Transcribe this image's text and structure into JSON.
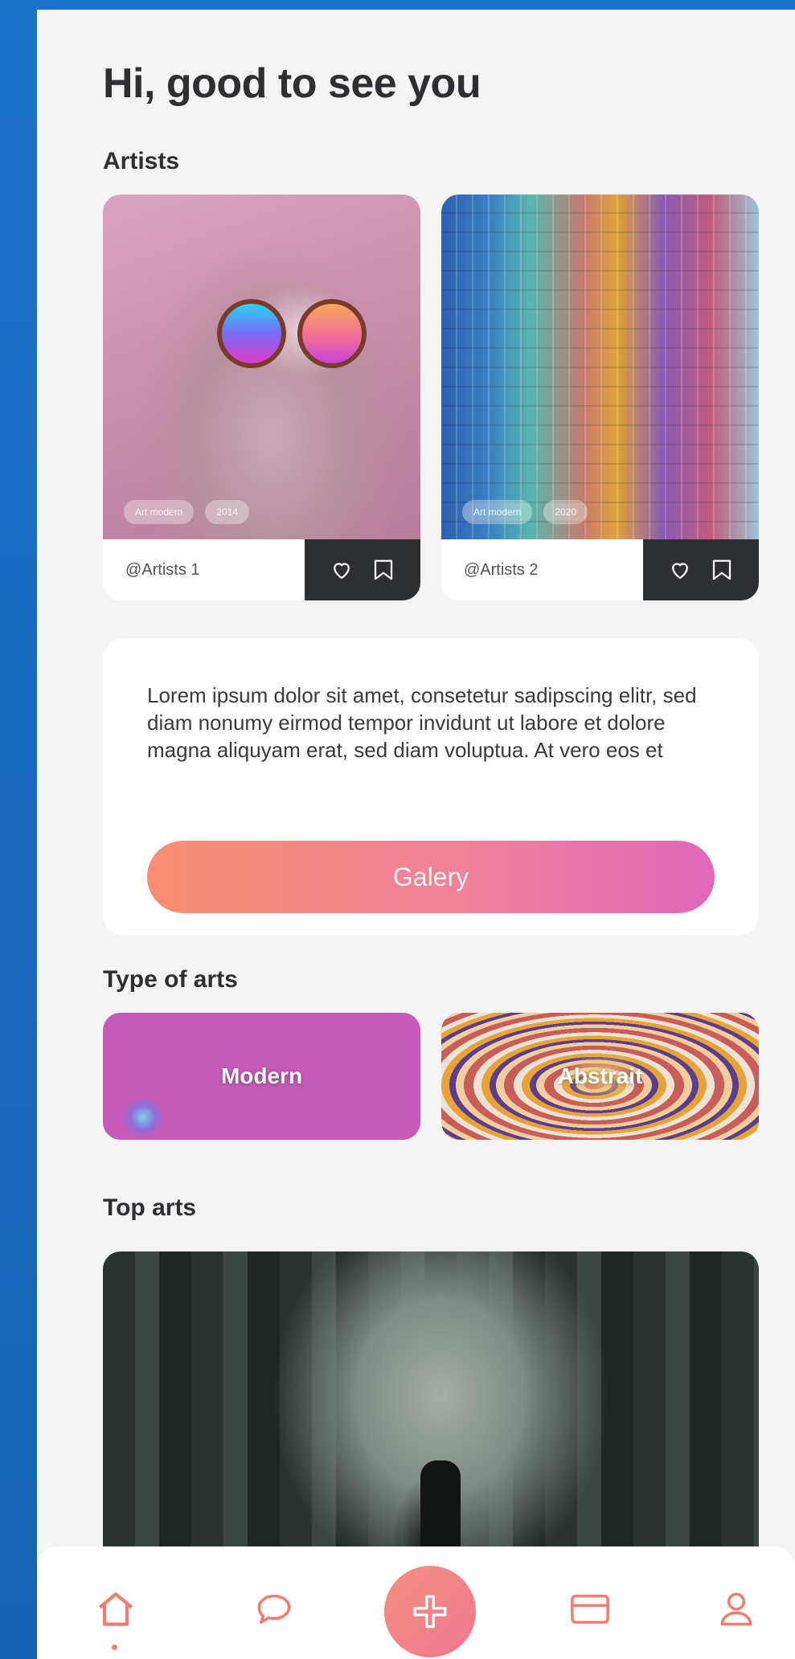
{
  "header": {
    "greeting": "Hi, good to see you"
  },
  "sections": {
    "artists_title": "Artists",
    "types_title": "Type of arts",
    "top_title": "Top arts"
  },
  "artists": [
    {
      "handle": "@Artists 1",
      "tags": [
        "Art modern",
        "2014"
      ]
    },
    {
      "handle": "@Artists 2",
      "tags": [
        "Art modern",
        "2020"
      ]
    }
  ],
  "info": {
    "text": "Lorem ipsum dolor sit amet, consetetur sadipscing elitr, sed diam nonumy eirmod tempor invidunt ut labore et dolore magna aliquyam erat, sed diam voluptua. At vero eos et",
    "button_label": "Galery"
  },
  "types": [
    {
      "label": "Modern"
    },
    {
      "label": "Abstrait"
    }
  ],
  "nav": {
    "items": [
      "home-icon",
      "chat-icon",
      "add-icon",
      "card-icon",
      "profile-icon"
    ],
    "active": "home-icon",
    "accent": "#f47c6e"
  },
  "colors": {
    "background": "#f4f4f5",
    "accent_start": "#f88f70",
    "accent_end": "#e268ba",
    "dark": "#2e2f33"
  }
}
